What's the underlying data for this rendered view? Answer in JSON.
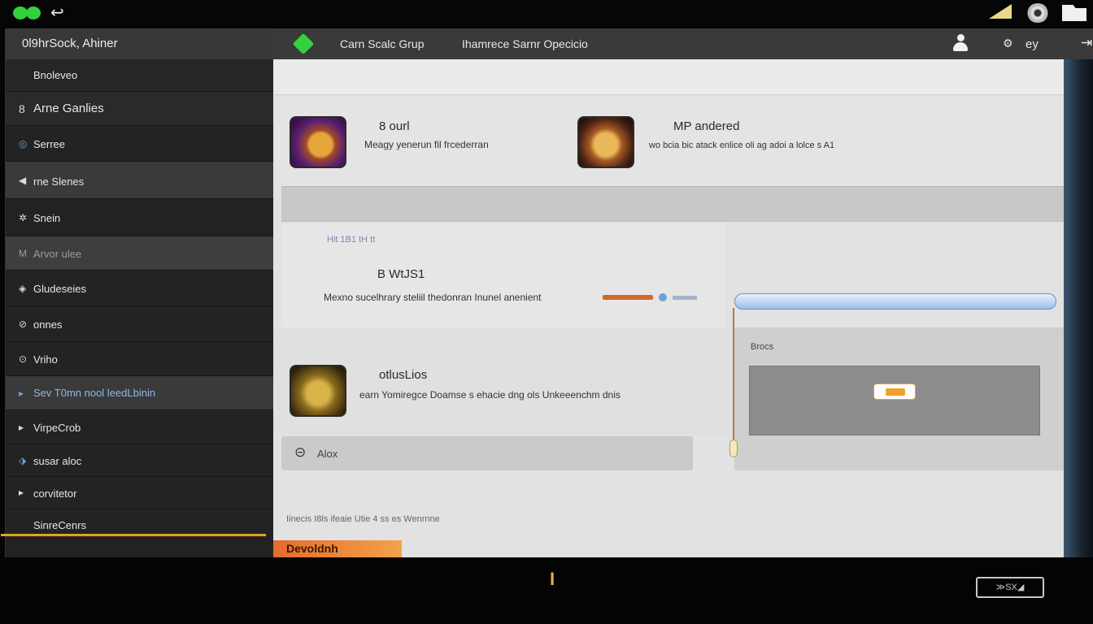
{
  "topbar": {
    "back_glyph": "↩"
  },
  "sidebar": {
    "title": "0l9hrSock, Ahiner",
    "items": [
      {
        "icon": "",
        "label": "Bnoleveo"
      },
      {
        "icon": "8",
        "label": "Arne Ganlies"
      },
      {
        "icon": "◎",
        "label": "Serree"
      },
      {
        "icon": "◀",
        "label": "rne Slenes"
      },
      {
        "icon": "✲",
        "label": "Snein"
      },
      {
        "icon": "M",
        "label": "Arvor ulee"
      },
      {
        "icon": "◈",
        "label": "Gludeseies"
      },
      {
        "icon": "⊘",
        "label": "onnes"
      },
      {
        "icon": "⊙",
        "label": "Vriho"
      },
      {
        "icon": "▸",
        "label": "Sev T0mn nool leedLbinin"
      },
      {
        "icon": "▸",
        "label": "VirpeCrob"
      },
      {
        "icon": "⬗",
        "label": "susar aloc"
      },
      {
        "icon": "▸",
        "label": "corvitetor"
      },
      {
        "icon": "",
        "label": "SinreCenrs"
      }
    ]
  },
  "header": {
    "title1": "Carn Scalc Grup",
    "title2": "Ihamrece Sarnr Opecicio",
    "key_label": "ey",
    "gear_glyph": "⚙",
    "exit_glyph": "⇥"
  },
  "main": {
    "card1": {
      "title": "8 ourl",
      "desc": "Meagy yenerun fil frcederran"
    },
    "card2": {
      "title": "MP andered",
      "desc": "wo bcia  bic atack enlice oli ag adoi a lolce  s A1"
    },
    "crumbs": "Hit 1B1 tH tt",
    "card3": {
      "title": "B WtJS1",
      "desc": "Mexno sucelhrary steliil thedonran Inunel anenient"
    },
    "card4": {
      "title": "otlusLios",
      "desc": "earn Yomiregce Doamse s ehacie dng ols Unkeeenchm dnis"
    },
    "panel": {
      "label": "Brocs"
    },
    "more": {
      "label": "Alox",
      "icon": "⊝"
    },
    "footer_text": "Iinecis I8ls ifeaie Utie 4 ss es Wenrnne",
    "dev_button": "Devoldnh",
    "progress": 0.65
  },
  "bottom": {
    "cursor": "I",
    "logo_text": "≫SX◢"
  },
  "colors": {
    "accent_green": "#33d23a",
    "accent_orange": "#e0a422",
    "slider_blue": "#9dbfe6"
  }
}
